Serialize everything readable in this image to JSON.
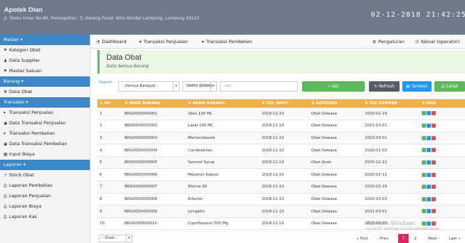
{
  "banner": {
    "title": "Apotek Dian",
    "address": "Jl. Teuku Umar No.99, Penengahan, Tj. Karang Pusat, Kota Bandar Lampung, Lampung 35123",
    "datetime": "02-12-2018 21:42:25"
  },
  "sidebar": {
    "master": {
      "label": "Master ▾",
      "items": [
        "Kategori Obat",
        "Data Supplier",
        "Master Satuan"
      ]
    },
    "barang": {
      "label": "Barang ▾",
      "items": [
        "Data Obat"
      ]
    },
    "transaksi": {
      "label": "Transaksi ▾",
      "items": [
        "Transaksi Penjualan",
        "Data Transaksi Penjualan",
        "Transaksi Pembelian",
        "Data Transaksi Pembelian",
        "Input Biaya"
      ]
    },
    "laporan": {
      "label": "Laporan ▾",
      "items": [
        "Stock Obat",
        "Laporan Pembelian",
        "Laporan Penjualan",
        "Laporan Biaya",
        "Laporan Kas"
      ]
    }
  },
  "topnav": {
    "dashboard": "Dashboard",
    "transaksi_penjualan": "Transaksi Penjualan",
    "transaksi_pembelian": "Transaksi Pembelian",
    "pengaturan": "Pengaturan",
    "keluar": "Keluar (operator)"
  },
  "page": {
    "title": "Data Obat",
    "subtitle": "Data Semua Barang"
  },
  "filters": {
    "search_label": "Search",
    "kategori_value": "- Semua Kategori -",
    "field_value": "NAMA BARAN",
    "search_placeholder": "cari ...",
    "go_label": "GO",
    "refresh_label": "Refresh",
    "tambah_label": "Tambah",
    "cetak_label": "Cetak"
  },
  "table": {
    "headers": [
      "NO",
      "KODE BARANG",
      "NAMA BARANG",
      "TGL INPUT",
      "KATEGORI",
      "TGL EXPIRED",
      "AKSI"
    ],
    "rows": [
      [
        "1",
        "BRG0000000001",
        "Silex 100 ML",
        "2018-11-10",
        "Obat Dewasa",
        "2020-02-29"
      ],
      [
        "2",
        "BRG0000000002",
        "Lasal 100 ML",
        "2018-11-10",
        "Obat Dewasa",
        "2021-03-01"
      ],
      [
        "3",
        "BRG0000000003",
        "Mertonidasole",
        "2018-11-10",
        "Obat Dewasa",
        "2023-03-01"
      ],
      [
        "4",
        "BRG0000000004",
        "Candesartan",
        "2018-11-10",
        "Obat Dewasa",
        "2020-01-03"
      ],
      [
        "5",
        "BRG0000000005",
        "Sanmol Syrup",
        "2018-11-10",
        "Obat Anak",
        "2020-12-21"
      ],
      [
        "6",
        "BRG0000000006",
        "Mezatrin Kapsul",
        "2018-11-10",
        "Obat Dewasa",
        "2020-12-11"
      ],
      [
        "7",
        "BRG0000000007",
        "Rhinos SR",
        "2018-11-10",
        "Obat Dewasa",
        "2020-02-29"
      ],
      [
        "8",
        "BRG0000000008",
        "Rifaster",
        "2018-11-10",
        "Obat Dewasa",
        "2020-10-03"
      ],
      [
        "9",
        "BRG0000000009",
        "Longatin",
        "2018-11-10",
        "Obat Dewasa",
        "2021-03-01"
      ],
      [
        "10",
        "BRG0000000010",
        "Ciprofloxacin 500 Mg",
        "2018-11-10",
        "Obat Dewasa",
        "2020-08-24"
      ]
    ]
  },
  "watermark": {
    "line1": "Activate Windows",
    "line2": "Go to PC settings to activate Windows."
  },
  "footer": {
    "show_label": "- Show -",
    "first": "« First",
    "prev": "‹ Prev",
    "pages": [
      "1",
      "2"
    ],
    "next": "Next ›",
    "last": "Last »"
  },
  "colors": {
    "banner": "#6c7a89",
    "sidebar_header": "#3d87c9",
    "table_header": "#f0ad4e",
    "go_button": "#5cb85c",
    "refresh_button": "#555c63",
    "tambah_button": "#2196f3",
    "cetak_button": "#5cb85c",
    "page_header_bg": "#ecf6e4",
    "active_page": "#e0245e"
  },
  "icons": {
    "sidebar_kategori": "tag-icon",
    "sidebar_supplier": "user-icon",
    "sidebar_satuan": "tag-icon",
    "sidebar_data_obat": "cubes-icon",
    "sidebar_transaksi_penjualan": "cart-icon",
    "sidebar_data_transaksi_penjualan": "pie-chart-icon",
    "sidebar_transaksi_pembelian": "cart-icon",
    "sidebar_data_transaksi_pembelian": "pie-chart-icon",
    "sidebar_input_biaya": "table-icon",
    "sidebar_stock_obat": "line-chart-icon",
    "sidebar_laporan": "print-icon",
    "nav_dashboard": "dashboard-icon",
    "nav_pengaturan": "gear-icon",
    "nav_keluar": "power-icon"
  }
}
